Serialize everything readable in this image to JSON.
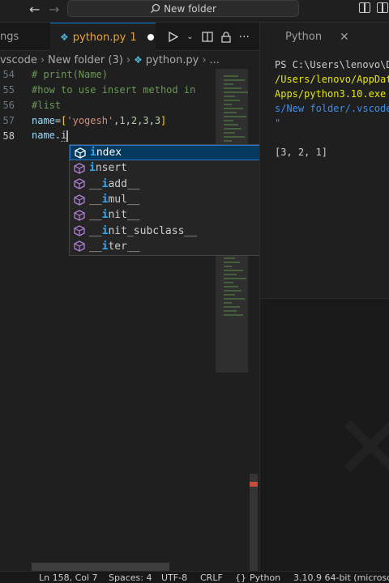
{
  "titlebar": {
    "search_text": "New folder",
    "back_icon": "arrow-left-icon",
    "forward_icon": "arrow-right-icon"
  },
  "tabs": {
    "inactive_label": "ngs",
    "active_label": "python.py",
    "active_problems": "1"
  },
  "breadcrumb": {
    "items": [
      "vscode",
      "New folder (3)",
      "python.py",
      "..."
    ]
  },
  "editor": {
    "lines": [
      {
        "num": "54",
        "text": "# print(Name)"
      },
      {
        "num": "55",
        "text": "#how to use insert method in"
      },
      {
        "num": "56",
        "text": "#list"
      },
      {
        "num": "57",
        "text": "name=['yogesh',1,2,3,3]"
      },
      {
        "num": "58",
        "text": "name.i"
      }
    ]
  },
  "suggestions": {
    "items": [
      {
        "pre": "",
        "hl": "i",
        "post": "ndex"
      },
      {
        "pre": "",
        "hl": "i",
        "post": "nsert"
      },
      {
        "pre": "__",
        "hl": "i",
        "post": "add__"
      },
      {
        "pre": "__",
        "hl": "i",
        "post": "mul__"
      },
      {
        "pre": "__",
        "hl": "i",
        "post": "nit__"
      },
      {
        "pre": "__",
        "hl": "i",
        "post": "nit_subclass__"
      },
      {
        "pre": "__",
        "hl": "i",
        "post": "ter__"
      }
    ]
  },
  "right_panel": {
    "title": "Python",
    "terminal_lines": [
      "PS C:\\Users\\lenovo\\D",
      "/Users/lenovo/AppDat",
      "Apps/python3.10.exe",
      "s/New folder/.vscode",
      "\"",
      "",
      "[3, 2, 1]"
    ]
  },
  "statusbar": {
    "position": "Ln 158, Col 7",
    "spaces": "Spaces: 4",
    "encoding": "UTF-8",
    "eol": "CRLF",
    "language": "Python",
    "interpreter": "3.10.9 64-bit (microso"
  },
  "colors": {
    "accent": "#0078d4",
    "suggest_highlight": "#2aaaff",
    "method_icon": "#b180d7"
  }
}
